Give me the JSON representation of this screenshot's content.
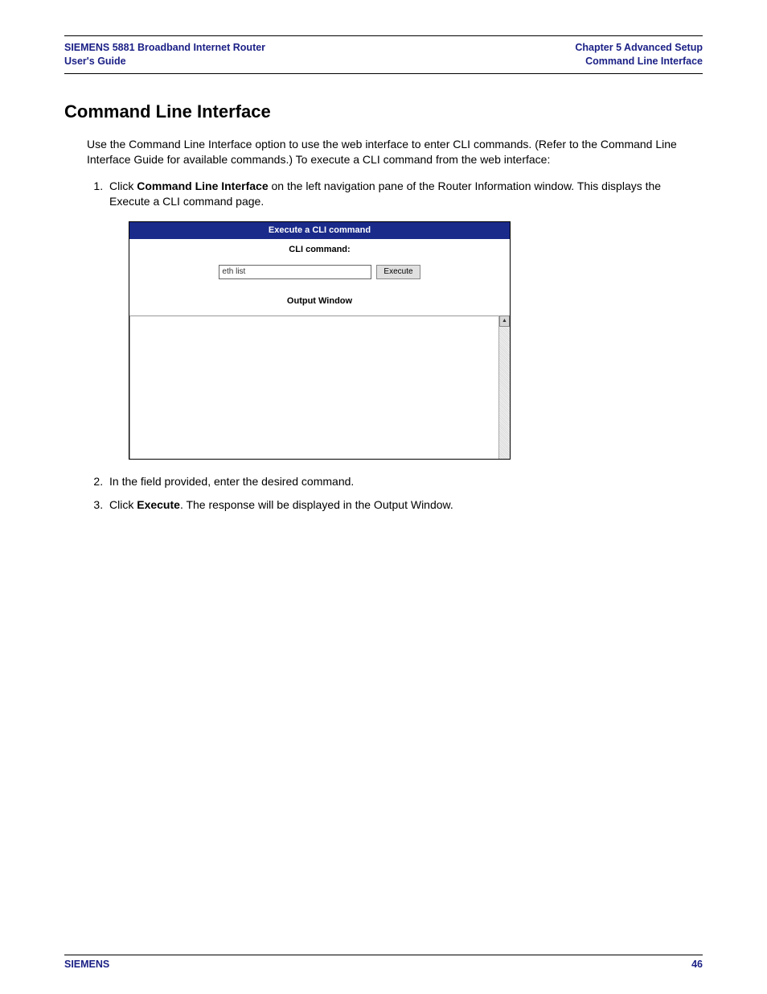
{
  "header": {
    "left_line1": "SIEMENS 5881 Broadband Internet Router",
    "left_line2": "User's Guide",
    "right_line1": "Chapter 5  Advanced Setup",
    "right_line2": "Command Line Interface"
  },
  "section_title": "Command Line Interface",
  "intro": "Use the Command Line Interface option to use the web interface to enter CLI commands. (Refer to the Command Line Interface Guide for available commands.) To execute a CLI command from the web interface:",
  "steps": {
    "s1_prefix": "Click ",
    "s1_bold": "Command Line Interface",
    "s1_suffix": " on the left navigation pane of the Router Information window. This displays the Execute a CLI command page.",
    "s2": "In the field provided, enter the desired command.",
    "s3_prefix": "Click ",
    "s3_bold": "Execute",
    "s3_suffix": ". The response will be displayed in the Output Window."
  },
  "cli": {
    "panel_title": "Execute a CLI command",
    "command_label": "CLI command:",
    "input_value": "eth list",
    "execute_label": "Execute",
    "output_label": "Output Window",
    "scroll_up_glyph": "▲"
  },
  "footer": {
    "brand": "SIEMENS",
    "page_number": "46"
  }
}
